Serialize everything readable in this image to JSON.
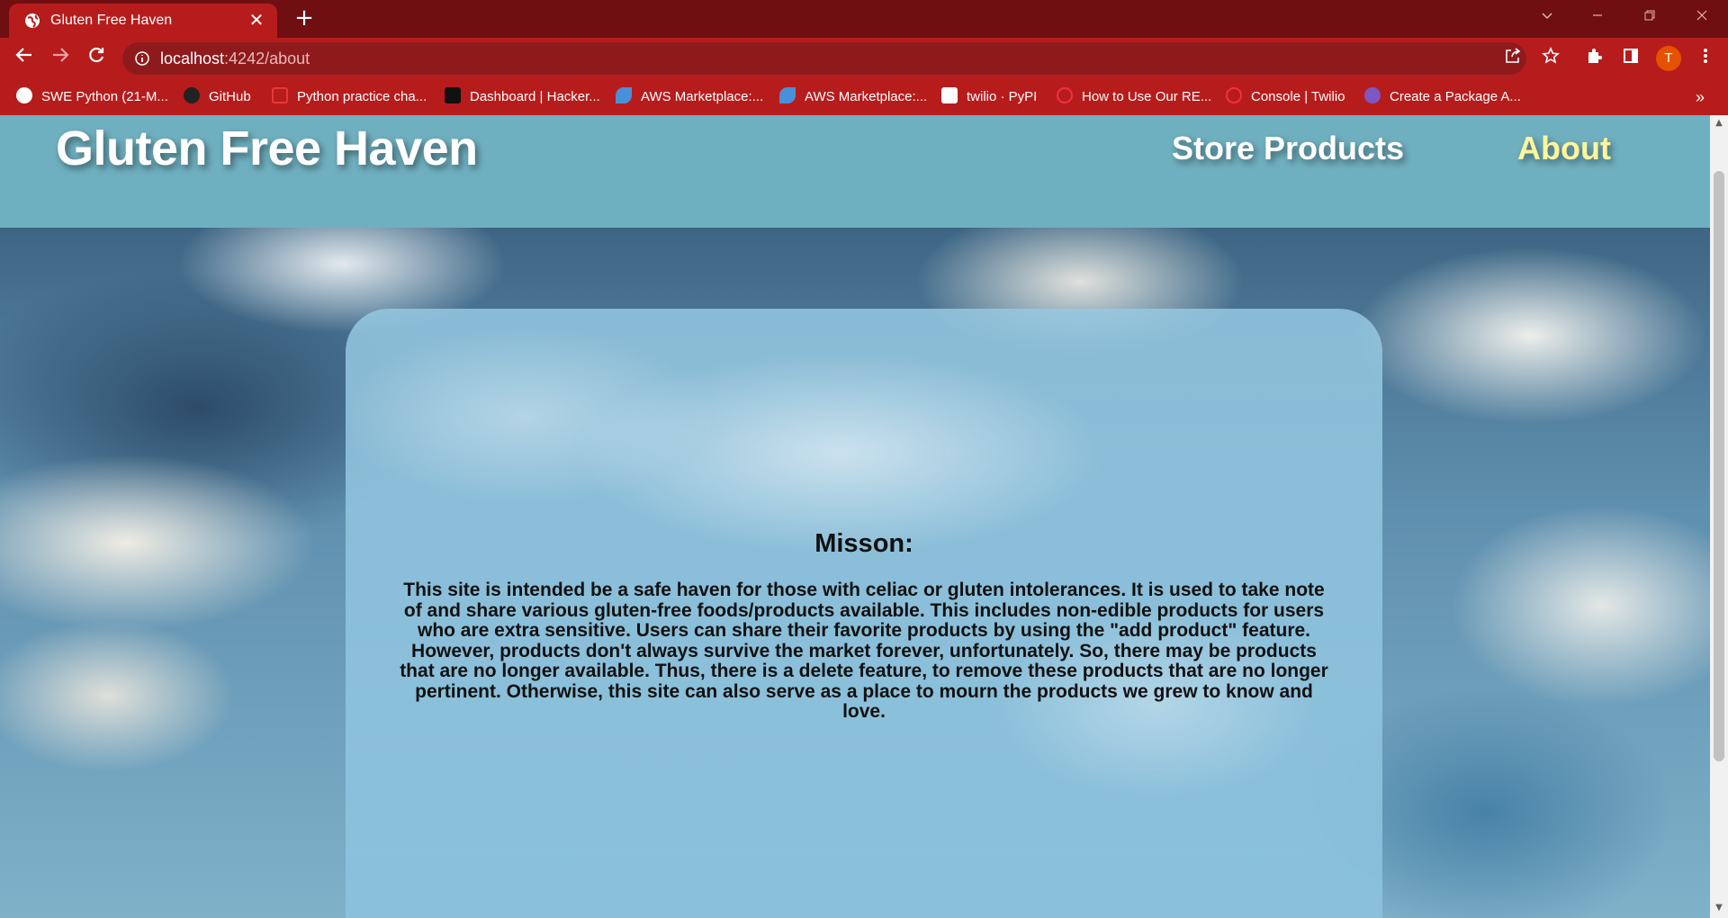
{
  "browser": {
    "tab_title": "Gluten Free Haven",
    "close_glyph": "✕",
    "new_tab_glyph": "+",
    "url_host": "localhost",
    "url_path": ":4242/about",
    "avatar_letter": "T",
    "bookmarks": [
      {
        "label": "SWE Python (21-M...",
        "icon": "globe-icon",
        "color": "#ffffff"
      },
      {
        "label": "GitHub",
        "icon": "github-icon",
        "color": "#222222"
      },
      {
        "label": "Python practice cha...",
        "icon": "practice-icon",
        "color": "#e53935"
      },
      {
        "label": "Dashboard | Hacker...",
        "icon": "hackerrank-icon",
        "color": "#111111"
      },
      {
        "label": "AWS Marketplace:...",
        "icon": "aws-icon",
        "color": "#4a90d9"
      },
      {
        "label": "AWS Marketplace:...",
        "icon": "aws-icon",
        "color": "#4a90d9"
      },
      {
        "label": "twilio · PyPI",
        "icon": "pypi-icon",
        "color": "#ffffff"
      },
      {
        "label": "How to Use Our RE...",
        "icon": "twilio-icon",
        "color": "#f22f46"
      },
      {
        "label": "Console | Twilio",
        "icon": "twilio-icon",
        "color": "#f22f46"
      },
      {
        "label": "Create a Package A...",
        "icon": "package-icon",
        "color": "#7e57c2"
      }
    ],
    "overflow_glyph": "»",
    "chrome_color": "#b71c1c",
    "titlebar_color": "#6f0f12"
  },
  "site": {
    "title": "Gluten Free Haven",
    "nav": [
      {
        "label": "Store Products",
        "color": "#ffffff"
      },
      {
        "label": "About",
        "color": "#fff59d"
      }
    ],
    "header_color": "#6fb0c0"
  },
  "mission": {
    "heading": "Misson:",
    "body": "This site is intended be a safe haven for those with celiac or gluten intolerances. It is used to take note of and share various gluten-free foods/products available. This includes non-edible products for users who are extra sensitive. Users can share their favorite products by using the \"add product\" feature. However, products don't always survive the market forever, unfortunately. So, there may be products that are no longer available. Thus, there is a delete feature, to remove these products that are no longer pertinent. Otherwise, this site can also serve as a place to mourn the products we grew to know and love."
  }
}
